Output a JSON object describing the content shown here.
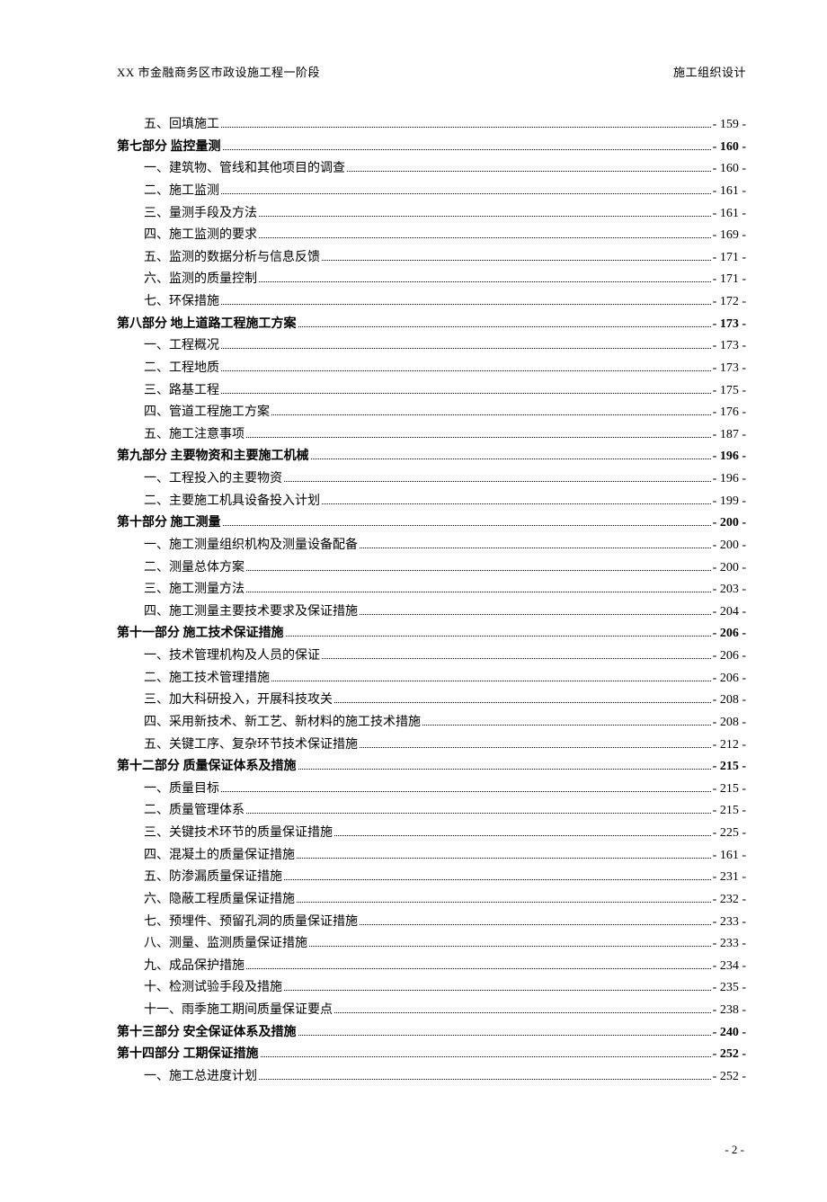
{
  "header": {
    "left": "XX 市金融商务区市政设施工程一阶段",
    "right": "施工组织设计"
  },
  "toc": [
    {
      "level": "item",
      "label": "五、回填施工",
      "page": "- 159 -"
    },
    {
      "level": "section",
      "label": "第七部分    监控量测",
      "page": "- 160 -"
    },
    {
      "level": "item",
      "label": "一、建筑物、管线和其他项目的调查",
      "page": "- 160 -"
    },
    {
      "level": "item",
      "label": "二、施工监测",
      "page": "- 161 -"
    },
    {
      "level": "item",
      "label": "三、量测手段及方法",
      "page": "- 161 -"
    },
    {
      "level": "item",
      "label": "四、施工监测的要求",
      "page": "- 169 -"
    },
    {
      "level": "item",
      "label": "五、监测的数据分析与信息反馈",
      "page": "- 171 -"
    },
    {
      "level": "item",
      "label": "六、监测的质量控制",
      "page": "- 171 -"
    },
    {
      "level": "item",
      "label": "七、环保措施",
      "page": "- 172 -"
    },
    {
      "level": "section",
      "label": "第八部分    地上道路工程施工方案",
      "page": "- 173 -"
    },
    {
      "level": "item",
      "label": "一、工程概况",
      "page": "- 173 -"
    },
    {
      "level": "item",
      "label": "二、工程地质",
      "page": "- 173 -"
    },
    {
      "level": "item",
      "label": "三、路基工程",
      "page": "- 175 -"
    },
    {
      "level": "item",
      "label": "四、管道工程施工方案",
      "page": "- 176 -"
    },
    {
      "level": "item",
      "label": "五、施工注意事项",
      "page": "- 187 -"
    },
    {
      "level": "section",
      "label": "第九部分   主要物资和主要施工机械",
      "page": "- 196 -"
    },
    {
      "level": "item",
      "label": "一、工程投入的主要物资",
      "page": "- 196 -"
    },
    {
      "level": "item",
      "label": "二、主要施工机具设备投入计划",
      "page": "- 199 -"
    },
    {
      "level": "section",
      "label": "第十部分    施工测量",
      "page": "- 200 -"
    },
    {
      "level": "item",
      "label": "一、施工测量组织机构及测量设备配备",
      "page": "- 200 -"
    },
    {
      "level": "item",
      "label": "二、测量总体方案",
      "page": "- 200 -"
    },
    {
      "level": "item",
      "label": "三、施工测量方法",
      "page": "- 203 -"
    },
    {
      "level": "item",
      "label": "四、施工测量主要技术要求及保证措施",
      "page": "- 204 -"
    },
    {
      "level": "section",
      "label": "第十一部分  施工技术保证措施",
      "page": "- 206 -"
    },
    {
      "level": "item",
      "label": "一、技术管理机构及人员的保证",
      "page": "- 206 -"
    },
    {
      "level": "item",
      "label": "二、施工技术管理措施",
      "page": "- 206 -"
    },
    {
      "level": "item",
      "label": "三、加大科研投入，开展科技攻关",
      "page": "- 208 -"
    },
    {
      "level": "item",
      "label": "四、采用新技术、新工艺、新材料的施工技术措施",
      "page": "- 208 -"
    },
    {
      "level": "item",
      "label": "五、关键工序、复杂环节技术保证措施",
      "page": "- 212 -"
    },
    {
      "level": "section",
      "label": "第十二部分  质量保证体系及措施",
      "page": "- 215 -"
    },
    {
      "level": "item",
      "label": "一、质量目标",
      "page": "- 215 -"
    },
    {
      "level": "item",
      "label": "二、质量管理体系",
      "page": "- 215 -"
    },
    {
      "level": "item",
      "label": "三、关键技术环节的质量保证措施",
      "page": "- 225 -"
    },
    {
      "level": "item",
      "label": "四、混凝土的质量保证措施",
      "page": "- 161 -"
    },
    {
      "level": "item",
      "label": "五、防渗漏质量保证措施",
      "page": "- 231 -"
    },
    {
      "level": "item",
      "label": "六、隐蔽工程质量保证措施",
      "page": "- 232 -"
    },
    {
      "level": "item",
      "label": "七、预埋件、预留孔洞的质量保证措施",
      "page": "- 233 -"
    },
    {
      "level": "item",
      "label": "八、测量、监测质量保证措施",
      "page": "- 233 -"
    },
    {
      "level": "item",
      "label": "九、成品保护措施",
      "page": "- 234 -"
    },
    {
      "level": "item",
      "label": "十、检测试验手段及措施",
      "page": "- 235 -"
    },
    {
      "level": "item",
      "label": "十一、雨季施工期间质量保证要点",
      "page": "- 238 -"
    },
    {
      "level": "section",
      "label": "第十三部分  安全保证体系及措施",
      "page": "- 240 -"
    },
    {
      "level": "section",
      "label": "第十四部分  工期保证措施",
      "page": "- 252 -"
    },
    {
      "level": "item",
      "label": "一、施工总进度计划",
      "page": "- 252 -"
    }
  ],
  "footer": {
    "page_number": "- 2 -"
  }
}
